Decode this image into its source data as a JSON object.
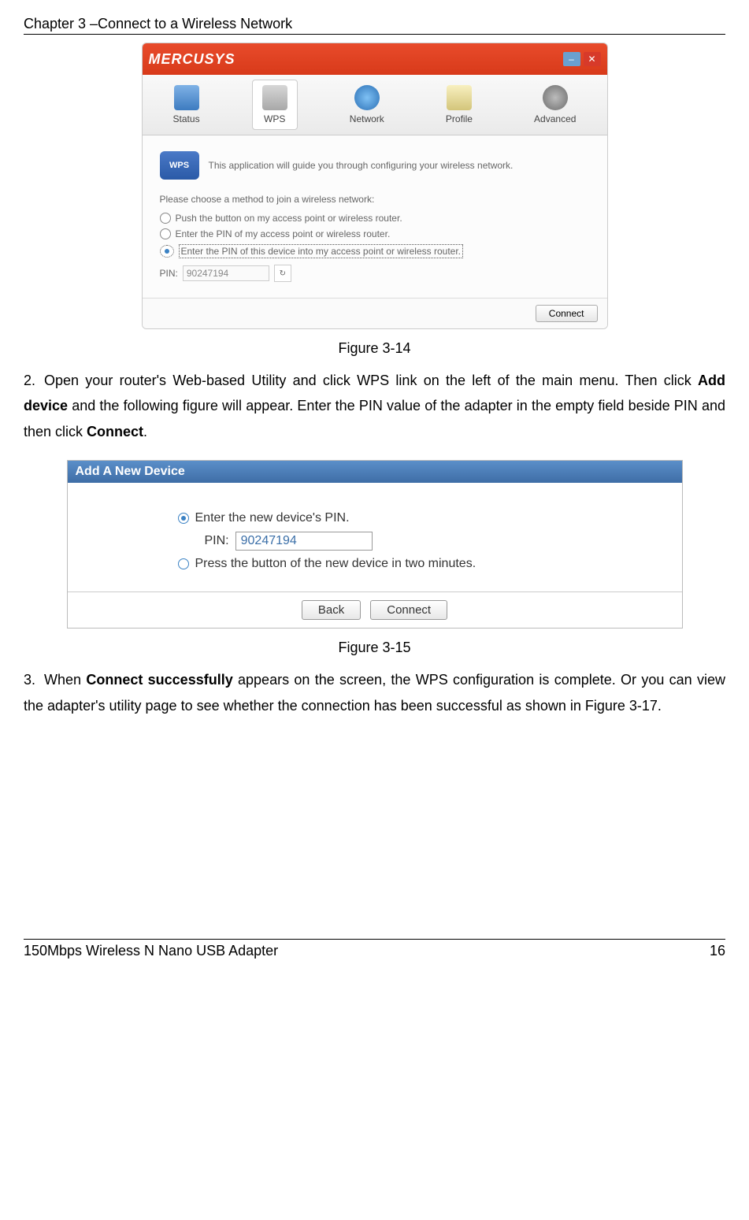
{
  "header": "Chapter 3 –Connect to a Wireless Network",
  "app": {
    "brand": "MERCUSYS",
    "tabs": {
      "status": "Status",
      "wps": "WPS",
      "network": "Network",
      "profile": "Profile",
      "advanced": "Advanced"
    },
    "wps_intro": "This application will guide you through configuring your wireless network.",
    "choose_label": "Please choose a method to join a wireless network:",
    "radio1": "Push the button on my access point or wireless router.",
    "radio2": "Enter the PIN of my access point or wireless router.",
    "radio3": "Enter the PIN of this device into my access point or wireless router.",
    "pin_label": "PIN:",
    "pin_value": "90247194",
    "connect_btn": "Connect"
  },
  "captions": {
    "fig14": "Figure 3-14",
    "fig15": "Figure 3-15"
  },
  "step2_pre": "2.",
  "step2_text_a": "Open your router's Web-based Utility and click WPS link on the left of the main menu. Then click ",
  "step2_bold1": "Add device",
  "step2_text_b": " and the following figure will appear. Enter the PIN value of the adapter in the empty field beside PIN and then click ",
  "step2_bold2": "Connect",
  "step2_text_c": ".",
  "add_device": {
    "title": "Add A New Device",
    "radio_pin": "Enter the new device's PIN.",
    "pin_label": "PIN:",
    "pin_value": "90247194",
    "radio_press": "Press the button of the new device in two minutes.",
    "back": "Back",
    "connect": "Connect"
  },
  "step3_pre": "3.",
  "step3_text_a": "When ",
  "step3_bold": "Connect successfully",
  "step3_text_b": " appears on the screen, the WPS configuration is complete. Or you can view the adapter's utility page to see whether the connection has been successful as shown in Figure 3-17.",
  "footer": {
    "left": "150Mbps Wireless N Nano USB Adapter",
    "right": "16"
  }
}
